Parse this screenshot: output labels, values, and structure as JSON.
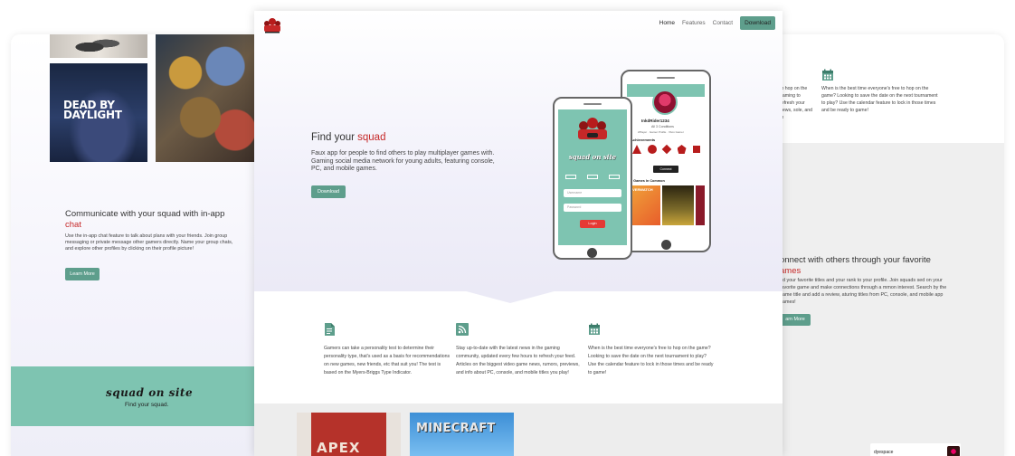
{
  "left_panel": {
    "poster_text": [
      "DEAD BY",
      "DAYLIGHT"
    ],
    "heading": "Communicate with your squad with in-app",
    "heading_accent": "chat",
    "body": "Use the in-app chat feature to talk about plans with your friends. Join group messaging or private message other gamers directly. Name your group chats, and explore other profiles by clicking on their profile picture!",
    "button_label": "Learn More",
    "banner_logo": "squad on site",
    "banner_tagline": "Find your squad."
  },
  "nav": {
    "items": [
      "Home",
      "Features",
      "Contact"
    ],
    "download_label": "Download"
  },
  "hero": {
    "title": "Find your",
    "title_accent": "squad",
    "description": "Faux app for people to find others to play multiplayer games with. Gaming social media network for young adults, featuring console, PC, and mobile games.",
    "button_label": "Download"
  },
  "phones": {
    "back_username": "InkdRider1234",
    "back_subtitle": "All 3 Conditions",
    "back_meta": "2Player · Gamer Profile · Xbox Gamer",
    "achievements_label": "Achievements",
    "connect_label": "Connect",
    "games_label": "5 Games In Common",
    "game1": "OVERWATCH",
    "front_logo": "squad on site",
    "username_placeholder": "Username",
    "password_placeholder": "Password",
    "login_label": "Login"
  },
  "features": [
    {
      "icon": "document-icon",
      "text": "Gamers can take a personality test to determine their personality type, that's used as a basis for recommendations on new games, new friends, etc that suit you! The test is based on the Myers-Briggs Type Indicator."
    },
    {
      "icon": "rss-icon",
      "text": "Stay up-to-date with the latest news in the gaming community, updated every few hours to refresh your feed. Articles on the biggest video game news, rumors, previews, and info about PC, console, and mobile titles you play!"
    },
    {
      "icon": "calendar-icon",
      "text": "When is the best time everyone's free to hop on the game? Looking to save the date on the next tournament to play? Use the calendar feature to lock in those times and be ready to game!"
    }
  ],
  "games": {
    "apex": "APEX",
    "minecraft": "MINECRAFT"
  },
  "right_panel": {
    "fragment": "to hop on the gaming to refresh your news, sole, and m",
    "calendar_text": "When is the best time everyone's free to hop on the game? Looking to save the date on the next tournament to play? Use the calendar feature to lock in those times and be ready to game!",
    "heading": "onnect with others through your favorite",
    "heading_accent": "ames",
    "body": "dd your favorite titles and your rank to your profile. Join squads sed on your favorite game and make connections through a mmon interest. Search by the game title and add a review, aturing titles from PC, console, and mobile app games!",
    "button_label": "arn More",
    "card_title": "dyespace"
  },
  "colors": {
    "accent": "#c62828",
    "primary": "#5e9e8c",
    "teal_bg": "#7ec4b1"
  }
}
